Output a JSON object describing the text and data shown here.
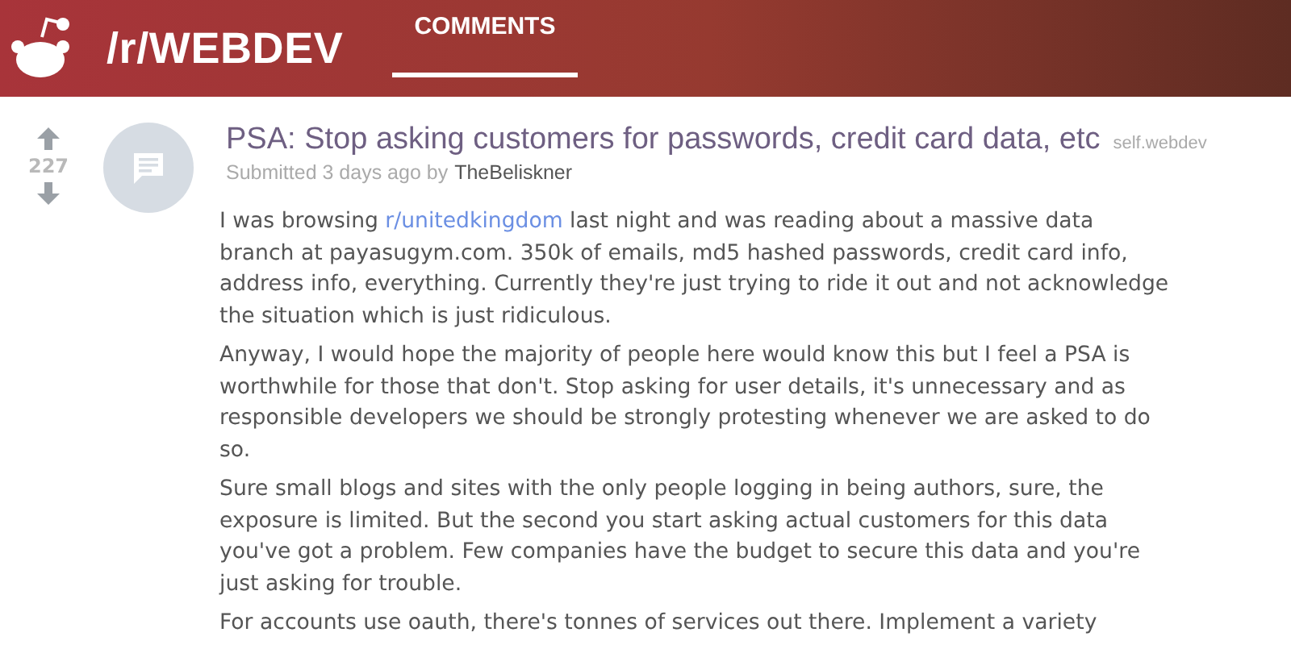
{
  "header": {
    "subreddit": "/r/WEBDEV",
    "tabs": [
      {
        "label": "COMMENTS",
        "selected": true
      }
    ]
  },
  "post": {
    "score": "227",
    "title": "PSA: Stop asking customers for passwords, credit card data, etc",
    "domain": "self.webdev",
    "submitted": "Submitted 3 days ago by",
    "author": "TheBeliskner",
    "paragraphs": [
      [
        {
          "kind": "text",
          "text": "I was browsing "
        },
        {
          "kind": "link",
          "text": "r/unitedkingdom"
        },
        {
          "kind": "text",
          "text": " last night and was reading about a massive data branch at payasugym.com. 350k of emails, md5 hashed passwords, credit card info, address info, everything. Currently they're just trying to ride it out and not acknowledge the situation which is just ridiculous."
        }
      ],
      [
        {
          "kind": "text",
          "text": "Anyway, I would hope the majority of people here would know this but I feel a PSA is worthwhile for those that don't. Stop asking for user details, it's unnecessary and as responsible developers we should be strongly protesting whenever we are asked to do so."
        }
      ],
      [
        {
          "kind": "text",
          "text": "Sure small blogs and sites with the only people logging in being authors, sure, the exposure is limited. But the second you start asking actual customers for this data you've got a problem. Few companies have the budget to secure this data and you're just asking for trouble."
        }
      ],
      [
        {
          "kind": "text",
          "text": "For accounts use oauth, there's tonnes of services out there. Implement a variety"
        }
      ]
    ]
  }
}
